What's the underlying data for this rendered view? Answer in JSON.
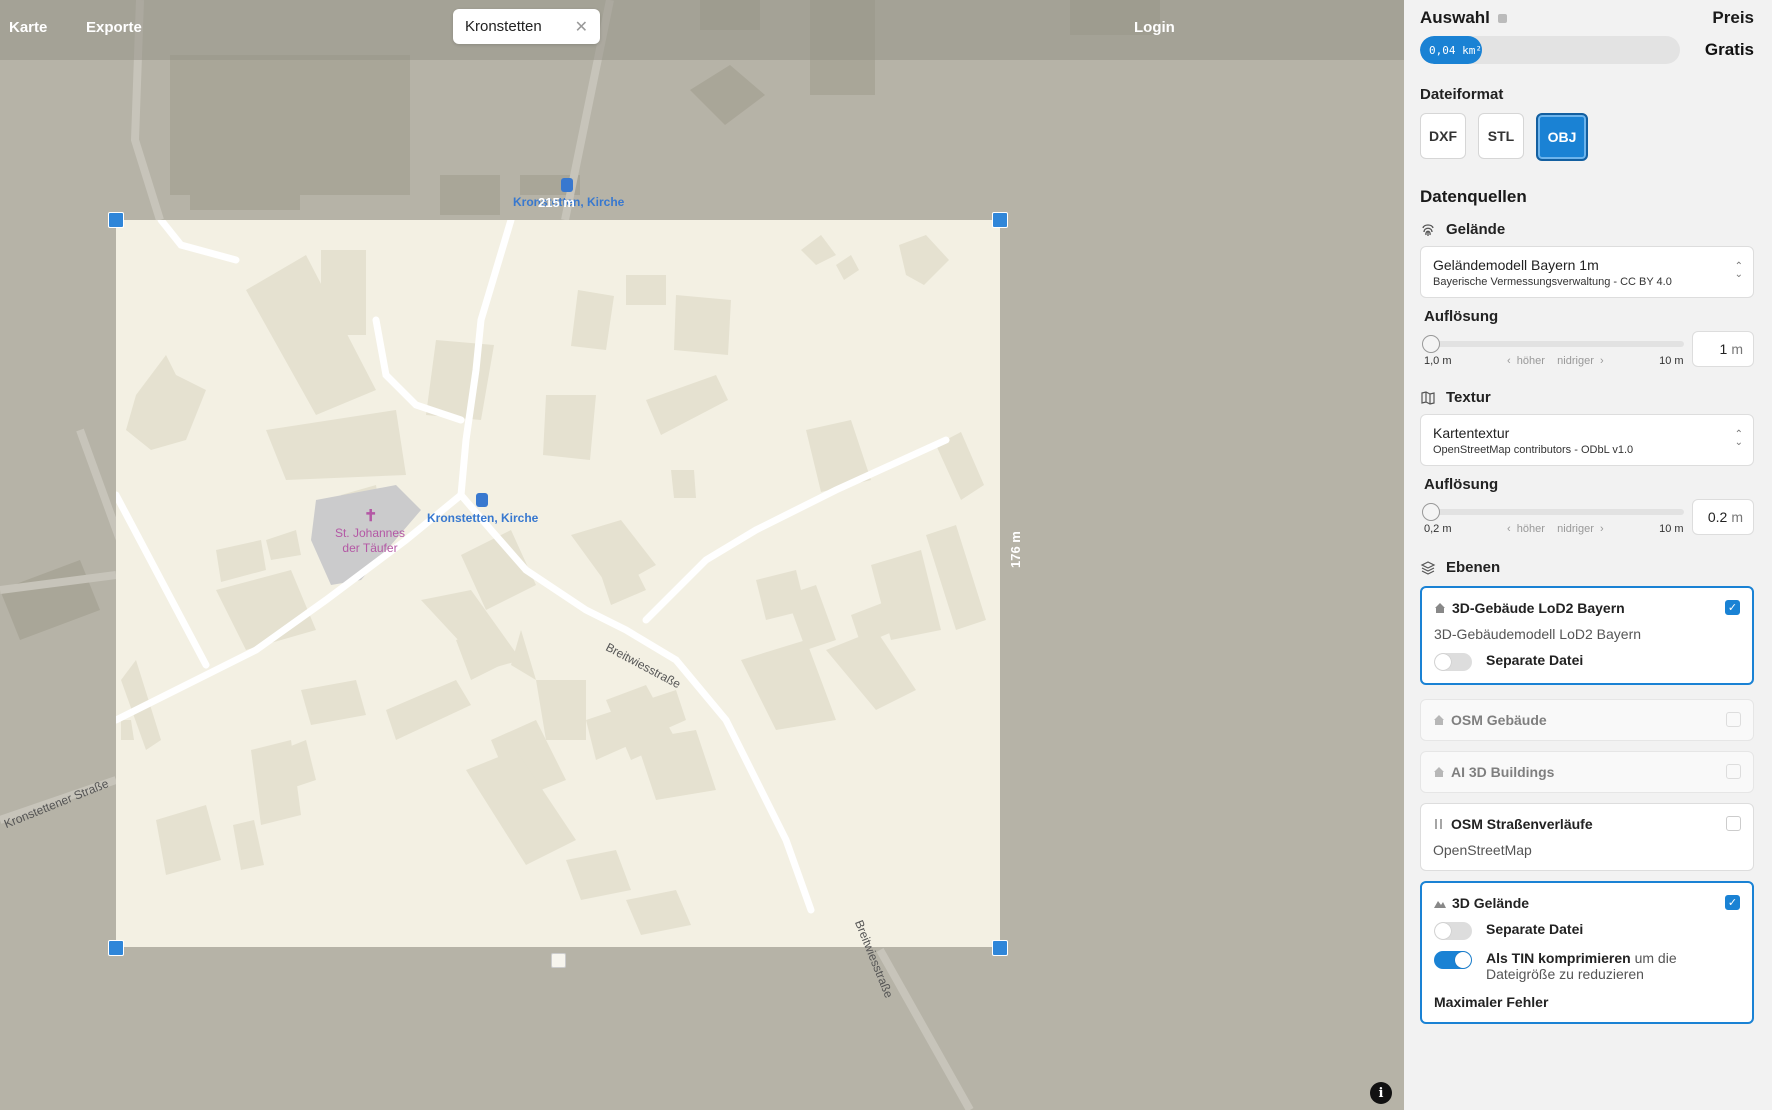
{
  "nav": {
    "karte": "Karte",
    "exporte": "Exporte",
    "login": "Login",
    "search_chip": "Kronstetten",
    "search_close": "✕"
  },
  "map": {
    "dim_width": "215 m",
    "dim_height": "176 m",
    "poi_bus_top": "Kronstetten, Kirche",
    "poi_bus_center": "Kronstetten, Kirche",
    "church_label": "St. Johannes der Täufer",
    "street_breitwies_1": "Breitwiesstraße",
    "street_breitwies_2": "Breitwiesstraße",
    "street_kronstettener": "Kronstettener Straße",
    "info": "i"
  },
  "panel": {
    "auswahl": "Auswahl",
    "preis": "Preis",
    "area_value": "0,04 km²",
    "area_fill_fraction": 0.24,
    "gratis": "Gratis",
    "dateiformat": "Dateiformat",
    "formats": [
      "DXF",
      "STL",
      "OBJ"
    ],
    "selected_format": "OBJ",
    "datenquellen": "Datenquellen",
    "gelaende": {
      "label": "Gelände",
      "title": "Geländemodell Bayern 1m",
      "subtitle": "Bayerische Vermessungsverwaltung - CC BY 4.0",
      "res_label": "Auflösung",
      "min": "1,0 m",
      "mid_left": "höher",
      "mid_right": "nidriger",
      "max": "10 m",
      "value": "1",
      "unit": "m"
    },
    "textur": {
      "label": "Textur",
      "title": "Kartentextur",
      "subtitle": "OpenStreetMap contributors - ODbL v1.0",
      "res_label": "Auflösung",
      "min": "0,2 m",
      "mid_left": "höher",
      "mid_right": "nidriger",
      "max": "10 m",
      "value": "0.2",
      "unit": "m"
    },
    "ebenen": "Ebenen",
    "layers": {
      "lod2": {
        "title": "3D-Gebäude LoD2 Bayern",
        "subtitle": "3D-Gebäudemodell LoD2 Bayern",
        "toggle": "Separate Datei",
        "checked": true
      },
      "osm_gebaeude": {
        "title": "OSM Gebäude",
        "checked": false
      },
      "ai_buildings": {
        "title": "AI 3D Buildings",
        "checked": false
      },
      "osm_strassen": {
        "title": "OSM Straßenverläufe",
        "subtitle": "OpenStreetMap",
        "checked": false
      },
      "gelaende3d": {
        "title": "3D Gelände",
        "toggle1": "Separate Datei",
        "toggle2_bold": "Als TIN komprimieren",
        "toggle2_rest": "um die Dateigröße zu reduzieren",
        "max_error": "Maximaler Fehler",
        "checked": true
      }
    }
  },
  "colors": {
    "accent": "#1a82d4",
    "selection": "#f3f0e3",
    "map_bg": "#b6b3a7"
  }
}
